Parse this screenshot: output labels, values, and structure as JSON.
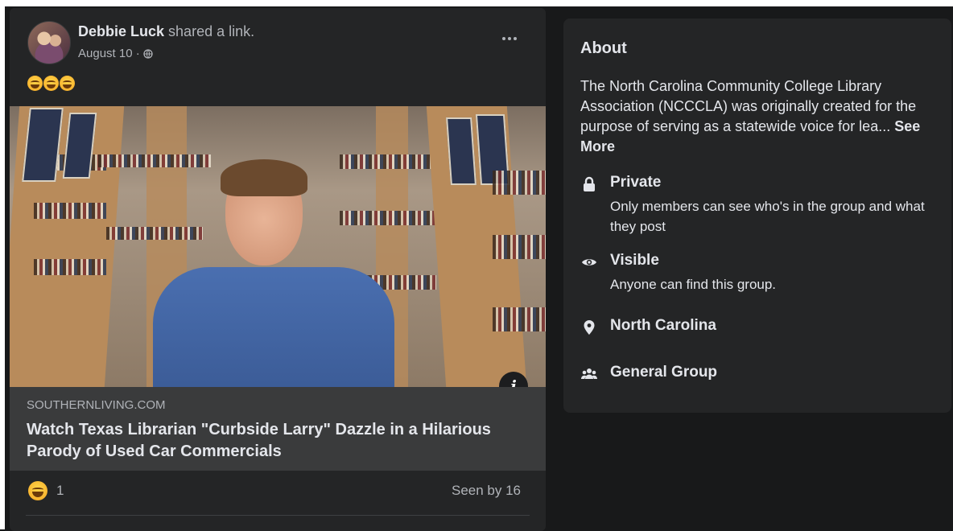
{
  "post": {
    "author": "Debbie Luck",
    "action": "shared a link.",
    "date": "August 10 ·",
    "emoji_icons": [
      "laughing-emoji",
      "laughing-emoji",
      "laughing-emoji"
    ],
    "link": {
      "domain": "SOUTHERNLIVING.COM",
      "title": "Watch Texas Librarian \"Curbside Larry\" Dazzle in a Hilarious Parody of Used Car Commercials"
    },
    "reactions": {
      "icon": "laughing-emoji",
      "count": "1"
    },
    "seen_by": "Seen by 16"
  },
  "about": {
    "title": "About",
    "description": "The North Carolina Community College Library Association (NCCCLA) was originally created for the purpose of serving as a statewide voice for lea...",
    "see_more": "See More",
    "rows": [
      {
        "icon": "lock-icon",
        "title": "Private",
        "subtitle": "Only members can see who's in the group and what they post"
      },
      {
        "icon": "eye-icon",
        "title": "Visible",
        "subtitle": "Anyone can find this group."
      },
      {
        "icon": "location-pin-icon",
        "title": "North Carolina"
      },
      {
        "icon": "group-icon",
        "title": "General Group"
      }
    ]
  }
}
